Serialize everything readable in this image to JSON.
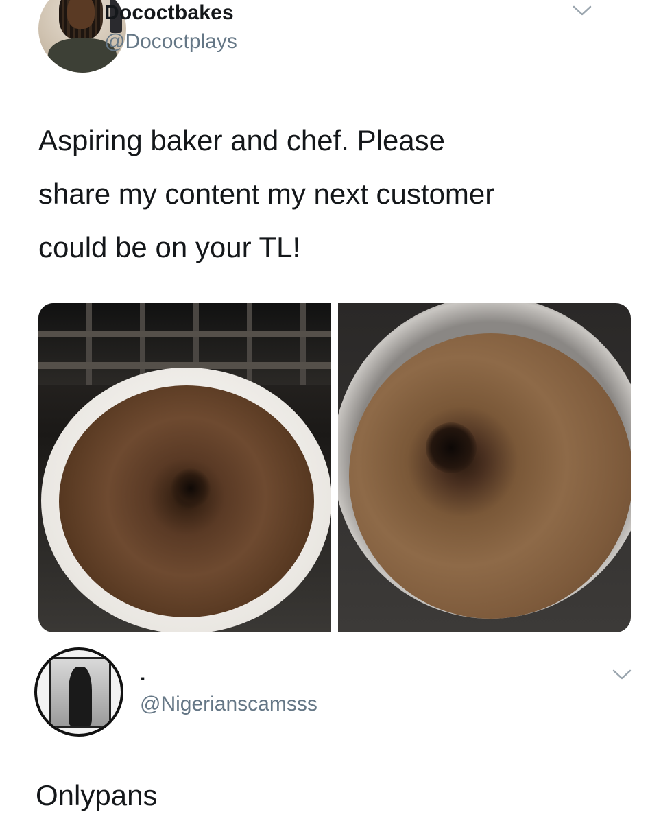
{
  "tweet": {
    "display_name": "Dococtbakes",
    "handle": "@Dococtplays",
    "text": "Aspiring baker and chef. Please\nshare my content my next customer\ncould be on your TL!",
    "media": {
      "photos": [
        "cake-ramekin-photo",
        "pan-photo"
      ]
    }
  },
  "reply": {
    "display_name": ".",
    "handle": "@Nigerianscamsss",
    "text": "Onlypans"
  },
  "colors": {
    "text": "#14171a",
    "secondary": "#657786",
    "background": "#ffffff"
  },
  "icons": {
    "menu": "chevron-down-icon"
  }
}
